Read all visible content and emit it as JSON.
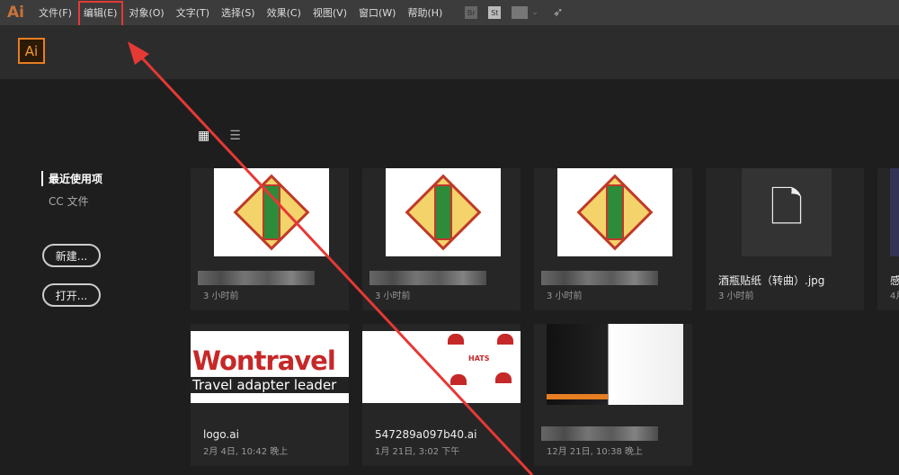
{
  "menubar": {
    "logo": "Ai",
    "items": [
      "文件(F)",
      "编辑(E)",
      "对象(O)",
      "文字(T)",
      "选择(S)",
      "效果(C)",
      "视图(V)",
      "窗口(W)",
      "帮助(H)"
    ],
    "tools": [
      "Br",
      "St"
    ]
  },
  "header": {
    "logo": "Ai"
  },
  "sidebar": {
    "recent": "最近使用项",
    "cc_files": "CC 文件",
    "new_button": "新建...",
    "open_button": "打开..."
  },
  "files": [
    {
      "name": "",
      "time": "3 小时前"
    },
    {
      "name": "",
      "time": "3 小时前"
    },
    {
      "name": "",
      "time": "3 小时前"
    },
    {
      "name": "酒瓶贴纸（转曲）.jpg",
      "time": "3 小时前"
    },
    {
      "name": "感",
      "time": "4月"
    },
    {
      "name": "logo.ai",
      "time": "2月 4日, 10:42 晚上",
      "thumb_text": [
        "Wontravel",
        "Travel adapter leader"
      ]
    },
    {
      "name": "547289a097b40.ai",
      "time": "1月 21日, 3:02 下午",
      "thumb_text": [
        "HATS"
      ]
    },
    {
      "name": "",
      "time": "12月 21日, 10:38 晚上"
    }
  ],
  "colors": {
    "accent": "#e67e22",
    "annotation": "#e53935"
  }
}
